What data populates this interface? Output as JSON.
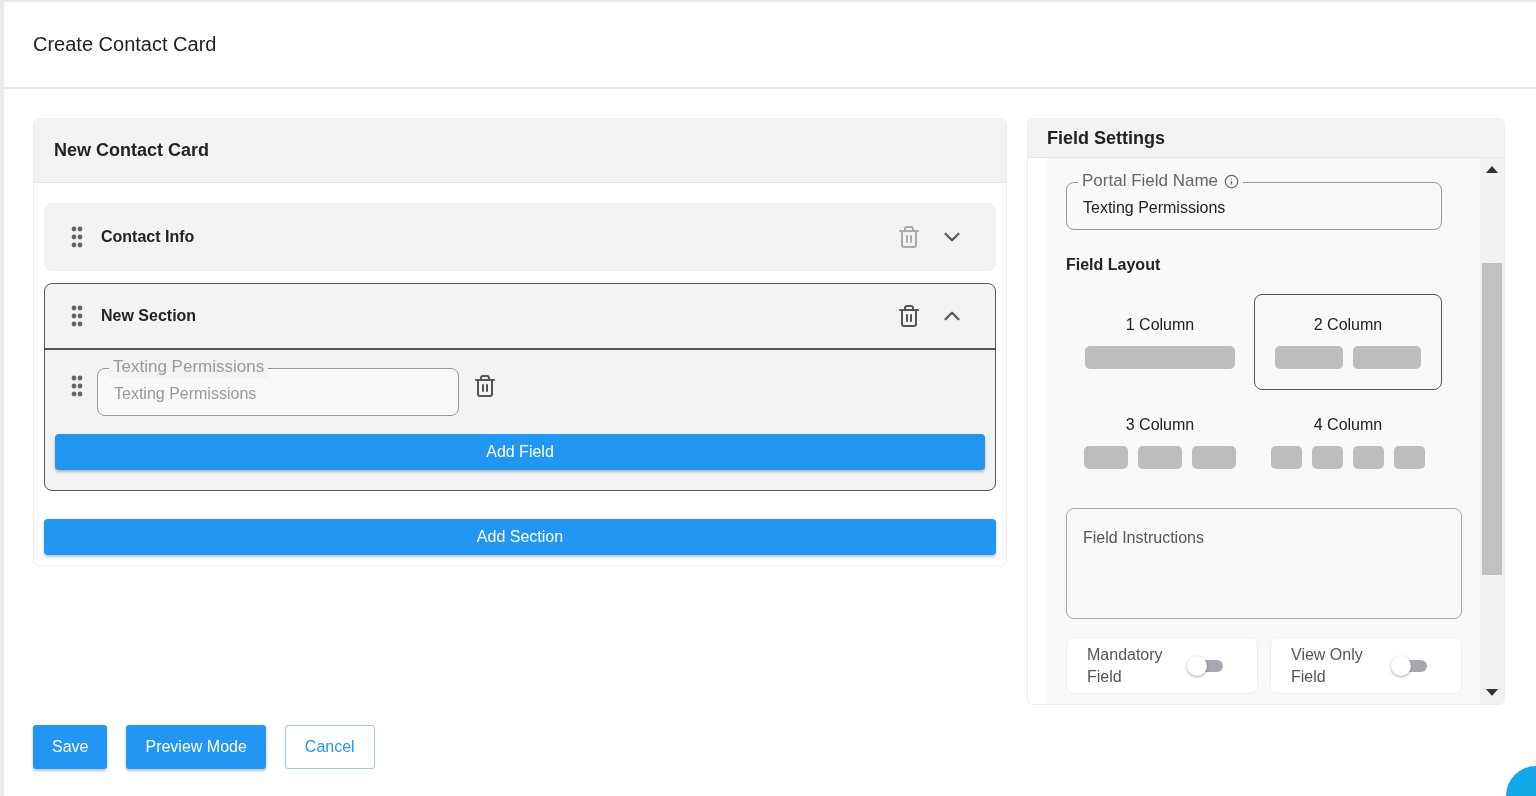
{
  "page": {
    "title": "Create Contact Card"
  },
  "card": {
    "title": "New Contact Card",
    "sections": [
      {
        "name": "Contact Info",
        "expanded": false,
        "delete_disabled": true
      },
      {
        "name": "New Section",
        "expanded": true,
        "delete_disabled": false,
        "fields": [
          {
            "label": "Texting Permissions",
            "value": "Texting Permissions"
          }
        ],
        "add_field": "Add Field"
      }
    ],
    "add_section": "Add Section"
  },
  "settings": {
    "title": "Field Settings",
    "portal_field_name": {
      "label": "Portal Field Name",
      "value": "Texting Permissions"
    },
    "layout_title": "Field Layout",
    "layouts": [
      {
        "label": "1 Column",
        "selected": false
      },
      {
        "label": "2 Column",
        "selected": true
      },
      {
        "label": "3 Column",
        "selected": false
      },
      {
        "label": "4 Column",
        "selected": false
      }
    ],
    "instructions": {
      "placeholder": "Field Instructions"
    },
    "toggles": [
      {
        "label": "Mandatory Field",
        "on": false
      },
      {
        "label": "View Only Field",
        "on": false
      }
    ]
  },
  "actions": [
    {
      "label": "Save",
      "kind": "primary"
    },
    {
      "label": "Preview Mode",
      "kind": "primary"
    },
    {
      "label": "Cancel",
      "kind": "outline"
    }
  ]
}
